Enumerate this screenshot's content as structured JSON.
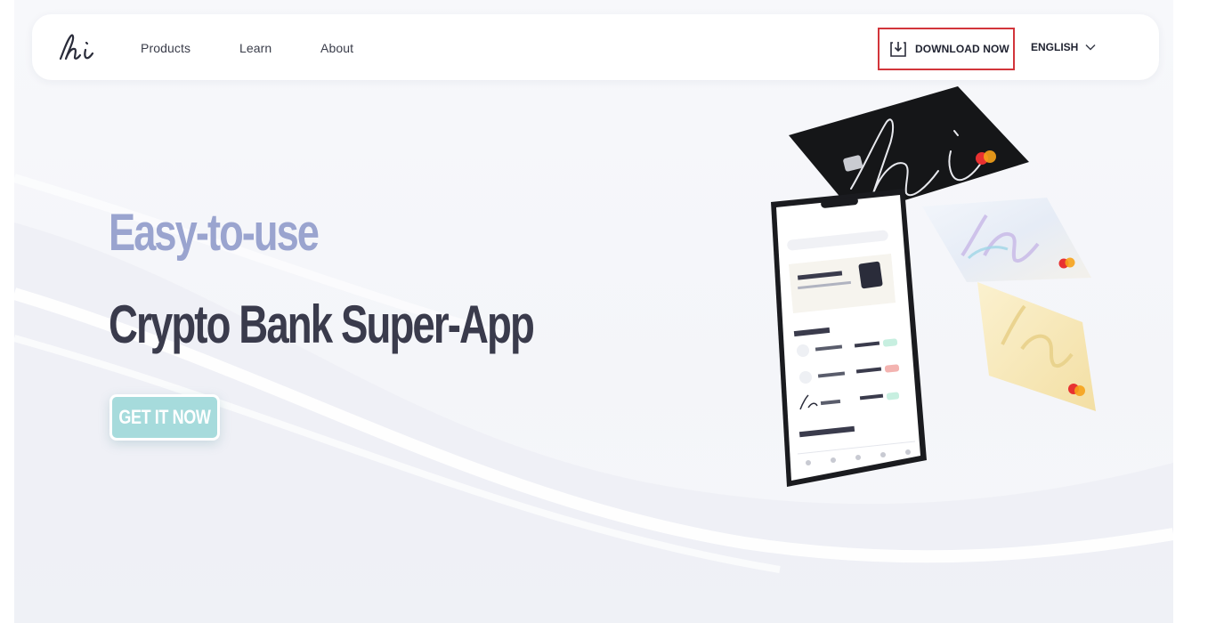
{
  "nav": {
    "links": [
      "Products",
      "Learn",
      "About"
    ],
    "download_label": "DOWNLOAD NOW",
    "language_label": "ENGLISH"
  },
  "hero": {
    "headline_top": "Easy-to-use",
    "headline_bottom": "Crypto Bank Super-App",
    "cta_label": "GET IT NOW"
  },
  "icons": {
    "logo": "hi-logo",
    "download": "download-icon",
    "chevron": "chevron-down-icon",
    "card_brand": "mastercard-icon"
  },
  "colors": {
    "headline_top": "#9aa4cf",
    "headline_bottom": "#3a3b4c",
    "cta_bg": "#a6dbdc",
    "download_border": "#d2353b"
  }
}
